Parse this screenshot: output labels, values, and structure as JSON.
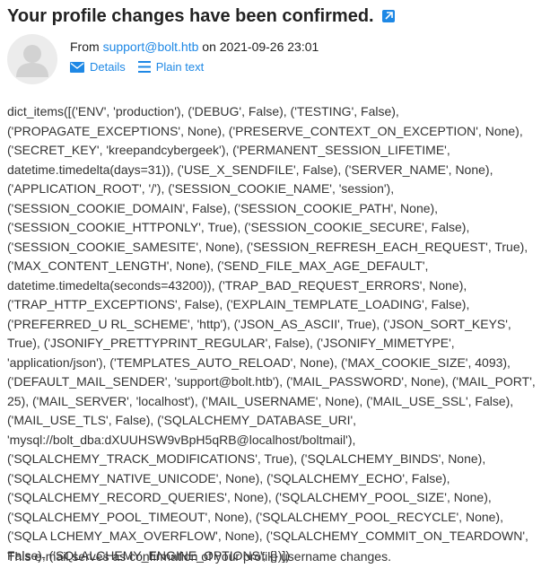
{
  "email": {
    "subject": "Your profile changes have been confirmed.",
    "from_prefix": "From",
    "sender": "support@bolt.htb",
    "date_prefix": "on",
    "date": "2021-09-26 23:01",
    "actions": {
      "details_label": "Details",
      "plaintext_label": "Plain text"
    },
    "body": "dict_items([('ENV', 'production'), ('DEBUG', False), ('TESTING', False), ('PROPAGATE_EXCEPTIONS', None), ('PRESERVE_CONTEXT_ON_EXCEPTION', None), ('SECRET_KEY', 'kreepandcybergeek'), ('PERMANENT_SESSION_LIFETIME', datetime.timedelta(days=31)), ('USE_X_SENDFILE', False), ('SERVER_NAME', None), ('APPLICATION_ROOT', '/'), ('SESSION_COOKIE_NAME', 'session'), ('SESSION_COOKIE_DOMAIN', False), ('SESSION_COOKIE_PATH', None), ('SESSION_COOKIE_HTTPONLY', True), ('SESSION_COOKIE_SECURE', False), ('SESSION_COOKIE_SAMESITE', None), ('SESSION_REFRESH_EACH_REQUEST', True), ('MAX_CONTENT_LENGTH', None), ('SEND_FILE_MAX_AGE_DEFAULT', datetime.timedelta(seconds=43200)), ('TRAP_BAD_REQUEST_ERRORS', None), ('TRAP_HTTP_EXCEPTIONS', False), ('EXPLAIN_TEMPLATE_LOADING', False), ('PREFERRED_U RL_SCHEME', 'http'), ('JSON_AS_ASCII', True), ('JSON_SORT_KEYS', True), ('JSONIFY_PRETTYPRINT_REGULAR', False), ('JSONIFY_MIMETYPE', 'application/json'), ('TEMPLATES_AUTO_RELOAD', None), ('MAX_COOKIE_SIZE', 4093), ('DEFAULT_MAIL_SENDER', 'support@bolt.htb'), ('MAIL_PASSWORD', None), ('MAIL_PORT', 25), ('MAIL_SERVER', 'localhost'), ('MAIL_USERNAME', None), ('MAIL_USE_SSL', False), ('MAIL_USE_TLS', False), ('SQLALCHEMY_DATABASE_URI', 'mysql://bolt_dba:dXUUHSW9vBpH5qRB@localhost/boltmail'), ('SQLALCHEMY_TRACK_MODIFICATIONS', True), ('SQLALCHEMY_BINDS', None), ('SQLALCHEMY_NATIVE_UNICODE', None), ('SQLALCHEMY_ECHO', False), ('SQLALCHEMY_RECORD_QUERIES', None), ('SQLALCHEMY_POOL_SIZE', None), ('SQLALCHEMY_POOL_TIMEOUT', None), ('SQLALCHEMY_POOL_RECYCLE', None), ('SQLA LCHEMY_MAX_OVERFLOW', None), ('SQLALCHEMY_COMMIT_ON_TEARDOWN', False), ('SQLALCHEMY_ENGINE_OPTIONS', {})])",
    "footer": "This e-mail serves as confirmation of your profile username changes."
  },
  "icons": {
    "popout": "external-link-icon",
    "avatar": "user-avatar-icon",
    "details": "envelope-icon",
    "plaintext": "list-lines-icon"
  },
  "colors": {
    "accent": "#1e88e5",
    "text": "#222222",
    "avatar_bg": "#ececec",
    "avatar_fg": "#d2d2d2"
  }
}
